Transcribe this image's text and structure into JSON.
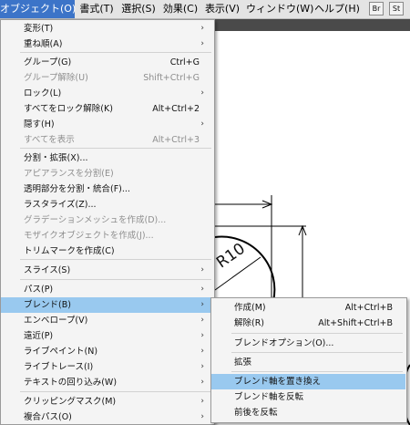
{
  "menubar": {
    "items": [
      {
        "label": "オブジェクト(O)",
        "active": true
      },
      {
        "label": "書式(T)"
      },
      {
        "label": "選択(S)"
      },
      {
        "label": "効果(C)"
      },
      {
        "label": "表示(V)"
      },
      {
        "label": "ウィンドウ(W)"
      },
      {
        "label": "ヘルプ(H)"
      }
    ],
    "icon_buttons": [
      {
        "label": "Br"
      },
      {
        "label": "St"
      }
    ]
  },
  "canvas": {
    "radius_label": "R10"
  },
  "object_menu": {
    "items": [
      {
        "label": "変形(T)",
        "shortcut": "",
        "submenu": true,
        "disabled": false
      },
      {
        "label": "重ね順(A)",
        "shortcut": "",
        "submenu": true,
        "disabled": false
      },
      {
        "label": "グループ(G)",
        "shortcut": "Ctrl+G",
        "submenu": false,
        "disabled": false
      },
      {
        "label": "グループ解除(U)",
        "shortcut": "Shift+Ctrl+G",
        "submenu": false,
        "disabled": true
      },
      {
        "label": "ロック(L)",
        "shortcut": "",
        "submenu": true,
        "disabled": false
      },
      {
        "label": "すべてをロック解除(K)",
        "shortcut": "Alt+Ctrl+2",
        "submenu": false,
        "disabled": false
      },
      {
        "label": "隠す(H)",
        "shortcut": "",
        "submenu": true,
        "disabled": false
      },
      {
        "label": "すべてを表示",
        "shortcut": "Alt+Ctrl+3",
        "submenu": false,
        "disabled": true
      },
      {
        "label": "分割・拡張(X)...",
        "shortcut": "",
        "submenu": false,
        "disabled": false
      },
      {
        "label": "アピアランスを分割(E)",
        "shortcut": "",
        "submenu": false,
        "disabled": true
      },
      {
        "label": "透明部分を分割・統合(F)...",
        "shortcut": "",
        "submenu": false,
        "disabled": false
      },
      {
        "label": "ラスタライズ(Z)...",
        "shortcut": "",
        "submenu": false,
        "disabled": false
      },
      {
        "label": "グラデーションメッシュを作成(D)...",
        "shortcut": "",
        "submenu": false,
        "disabled": true
      },
      {
        "label": "モザイクオブジェクトを作成(J)...",
        "shortcut": "",
        "submenu": false,
        "disabled": true
      },
      {
        "label": "トリムマークを作成(C)",
        "shortcut": "",
        "submenu": false,
        "disabled": false
      },
      {
        "label": "スライス(S)",
        "shortcut": "",
        "submenu": true,
        "disabled": false
      },
      {
        "label": "パス(P)",
        "shortcut": "",
        "submenu": true,
        "disabled": false
      },
      {
        "label": "ブレンド(B)",
        "shortcut": "",
        "submenu": true,
        "disabled": false,
        "highlighted": true
      },
      {
        "label": "エンベロープ(V)",
        "shortcut": "",
        "submenu": true,
        "disabled": false
      },
      {
        "label": "遠近(P)",
        "shortcut": "",
        "submenu": true,
        "disabled": false
      },
      {
        "label": "ライブペイント(N)",
        "shortcut": "",
        "submenu": true,
        "disabled": false
      },
      {
        "label": "ライブトレース(I)",
        "shortcut": "",
        "submenu": true,
        "disabled": false
      },
      {
        "label": "テキストの回り込み(W)",
        "shortcut": "",
        "submenu": true,
        "disabled": false
      },
      {
        "label": "クリッピングマスク(M)",
        "shortcut": "",
        "submenu": true,
        "disabled": false
      },
      {
        "label": "複合パス(O)",
        "shortcut": "",
        "submenu": true,
        "disabled": false
      }
    ]
  },
  "blend_submenu": {
    "items": [
      {
        "label": "作成(M)",
        "shortcut": "Alt+Ctrl+B"
      },
      {
        "label": "解除(R)",
        "shortcut": "Alt+Shift+Ctrl+B"
      },
      {
        "label": "ブレンドオプション(O)...",
        "shortcut": ""
      },
      {
        "label": "拡張",
        "shortcut": ""
      },
      {
        "label": "ブレンド軸を置き換え",
        "shortcut": "",
        "highlighted": true
      },
      {
        "label": "ブレンド軸を反転",
        "shortcut": ""
      },
      {
        "label": "前後を反転",
        "shortcut": ""
      }
    ]
  },
  "submenu_arrow": "›"
}
